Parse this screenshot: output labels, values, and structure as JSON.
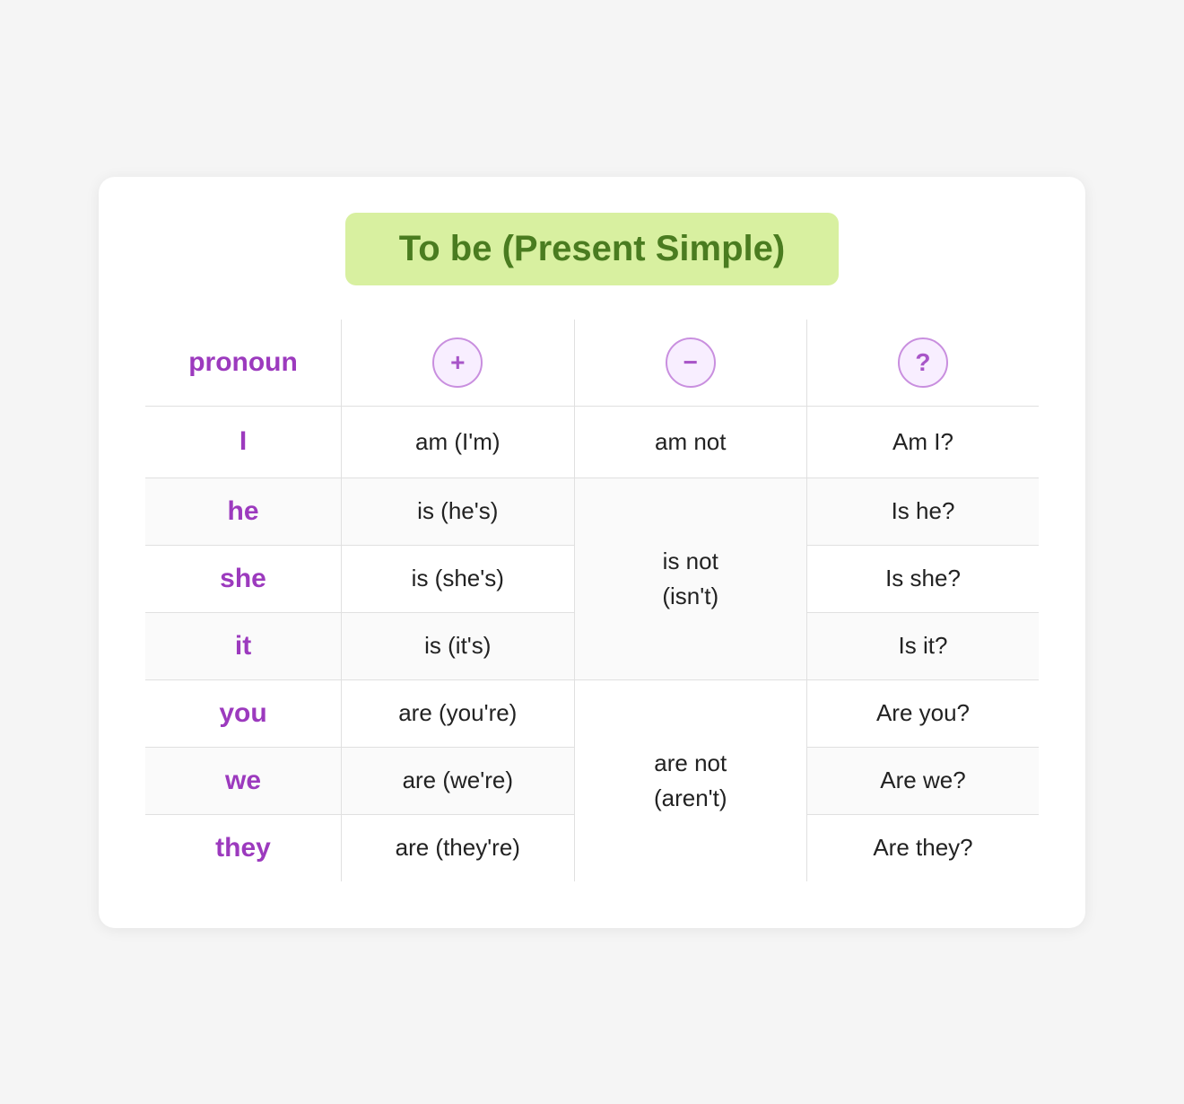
{
  "title": "To be (Present Simple)",
  "table": {
    "headers": {
      "pronoun": "pronoun",
      "positive_symbol": "+",
      "negative_symbol": "−",
      "question_symbol": "?"
    },
    "rows": [
      {
        "pronoun": "I",
        "positive": "am (I'm)",
        "negative": "am not",
        "question": "Am I?"
      },
      {
        "pronoun": "he",
        "positive": "is (he's)",
        "negative": null,
        "question": "Is he?"
      },
      {
        "pronoun": "she",
        "positive": "is (she's)",
        "negative": "is not\n(isn't)",
        "negative_merged": true,
        "question": "Is she?"
      },
      {
        "pronoun": "it",
        "positive": "is (it's)",
        "negative": null,
        "question": "Is it?"
      },
      {
        "pronoun": "you",
        "positive": "are (you're)",
        "negative": null,
        "question": "Are you?"
      },
      {
        "pronoun": "we",
        "positive": "are (we're)",
        "negative": "are not\n(aren't)",
        "negative_merged": true,
        "question": "Are we?"
      },
      {
        "pronoun": "they",
        "positive": "are (they're)",
        "negative": null,
        "question": "Are they?"
      }
    ]
  }
}
